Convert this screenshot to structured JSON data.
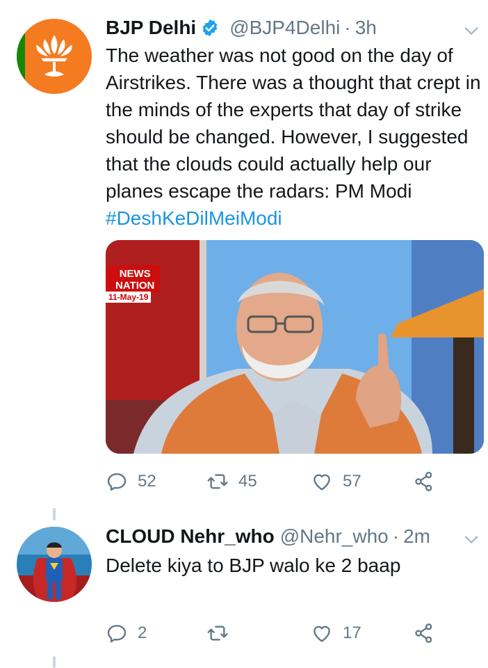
{
  "tweets": [
    {
      "display_name": "BJP Delhi",
      "verified": true,
      "handle": "@BJP4Delhi",
      "separator": "·",
      "time": "3h",
      "text": "The weather was not good on the day of Airstrikes. There was a thought that crept in the minds of the experts that day of strike should be changed. However, I suggested that the clouds could actually help our planes escape the radars: PM Modi ",
      "hashtag": "#DeshKeDilMeiModi",
      "media": {
        "channel_logo_line1": "NEWS",
        "channel_logo_line2": "NATION",
        "date_label": "11-May-19"
      },
      "replies": "52",
      "retweets": "45",
      "likes": "57"
    },
    {
      "display_name": "CLOUD Nehr_who",
      "handle": "@Nehr_who",
      "separator": "·",
      "time": "2m",
      "text": "Delete kiya to BJP walo ke 2 baap",
      "replies": "2",
      "retweets": "",
      "likes": "17"
    }
  ],
  "colors": {
    "link": "#1b95e0",
    "secondary_text": "#657786",
    "verified_badge": "#1da1f2",
    "bjp_orange": "#f47b20",
    "bjp_green": "#138808"
  },
  "icons": [
    "verified-badge-icon",
    "chevron-down-icon",
    "reply-icon",
    "retweet-icon",
    "like-heart-icon",
    "share-icon",
    "lotus-logo-icon"
  ]
}
